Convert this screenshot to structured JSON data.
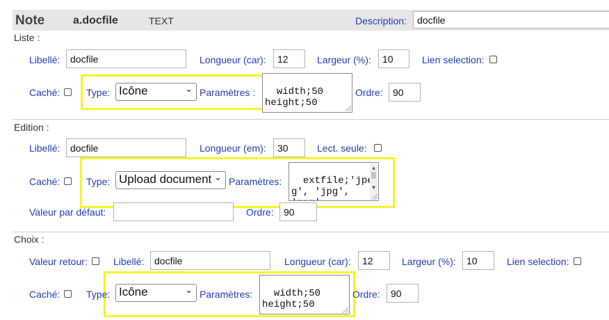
{
  "header": {
    "title": "Note",
    "name": "a.docfile",
    "type": "TEXT",
    "description_label": "Description:",
    "description_value": "docfile"
  },
  "liste": {
    "section_label": "Liste :",
    "libelle_label": "Libellé:",
    "libelle_value": "docfile",
    "longueur_label": "Longueur (car):",
    "longueur_value": "12",
    "largeur_label": "Largeur (%):",
    "largeur_value": "10",
    "lien_label": "Lien selection:",
    "cache_label": "Caché:",
    "type_label": "Type:",
    "type_value": "Icône",
    "parametres_label": "Paramètres :",
    "parametres_value": "width;50\nheight;50",
    "ordre_label": "Ordre:",
    "ordre_value": "90"
  },
  "edition": {
    "section_label": "Edition :",
    "libelle_label": "Libellé:",
    "libelle_value": "docfile",
    "longueur_label": "Longueur (em):",
    "longueur_value": "30",
    "lect_label": "Lect. seule:",
    "cache_label": "Caché:",
    "type_label": "Type:",
    "type_value": "Upload document",
    "parametres_label": "Paramètres:",
    "parametres_value": "extfile;'jpe\ng', 'jpg',\n'png',",
    "valeur_label": "Valeur par défaut:",
    "valeur_value": "",
    "ordre_label": "Ordre:",
    "ordre_value": "90"
  },
  "choix": {
    "section_label": "Choix :",
    "valeur_retour_label": "Valeur retour:",
    "libelle_label": "Libellé:",
    "libelle_value": "docfile",
    "longueur_label": "Longueur (car):",
    "longueur_value": "12",
    "largeur_label": "Largeur (%):",
    "largeur_value": "10",
    "lien_label": "Lien selection:",
    "cache_label": "Caché:",
    "type_label": "Type:",
    "type_value": "Icône",
    "parametres_label": "Paramètres:",
    "parametres_value": "width;50\nheight;50",
    "ordre_label": "Ordre:",
    "ordre_value": "90"
  },
  "colors": {
    "label_blue": "#1f3fb0",
    "highlight": "#f6f42a",
    "header_bg": "#e6e6e6"
  },
  "icons": {
    "select_arrow": "chevron-down-icon",
    "resize": "resize-grip-icon"
  }
}
